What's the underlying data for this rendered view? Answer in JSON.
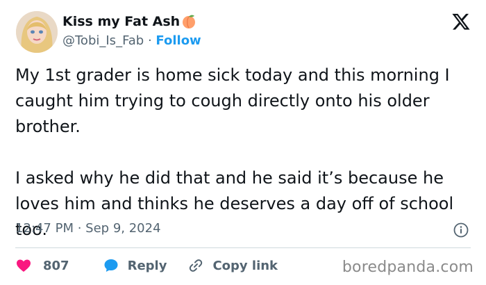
{
  "author": {
    "display_name": "Kiss my Fat Ash",
    "handle": "@Tobi_Is_Fab",
    "separator": "·",
    "follow_label": "Follow"
  },
  "tweet": {
    "paragraphs": [
      "My 1st grader is home sick today and this morning I caught him trying to cough directly onto his older brother.",
      "I asked why he did that and he said it’s because he loves him and thinks he deserves a day off of school too."
    ],
    "time": "12:47 PM",
    "date": "Sep 9, 2024",
    "meta_separator": "·"
  },
  "actions": {
    "like_count": "807",
    "reply_label": "Reply",
    "copy_link_label": "Copy link"
  },
  "watermark": "boredpanda.com",
  "icons": {
    "like": "heart-icon",
    "reply": "speech-bubble-icon",
    "copy": "link-icon",
    "info": "info-icon",
    "brand": "x-logo-icon",
    "emoji": "peach-icon"
  },
  "colors": {
    "like": "#f91880",
    "reply": "#1d9bf0",
    "follow": "#1d9bf0",
    "secondary_text": "#536471",
    "divider": "#cfd9de"
  }
}
